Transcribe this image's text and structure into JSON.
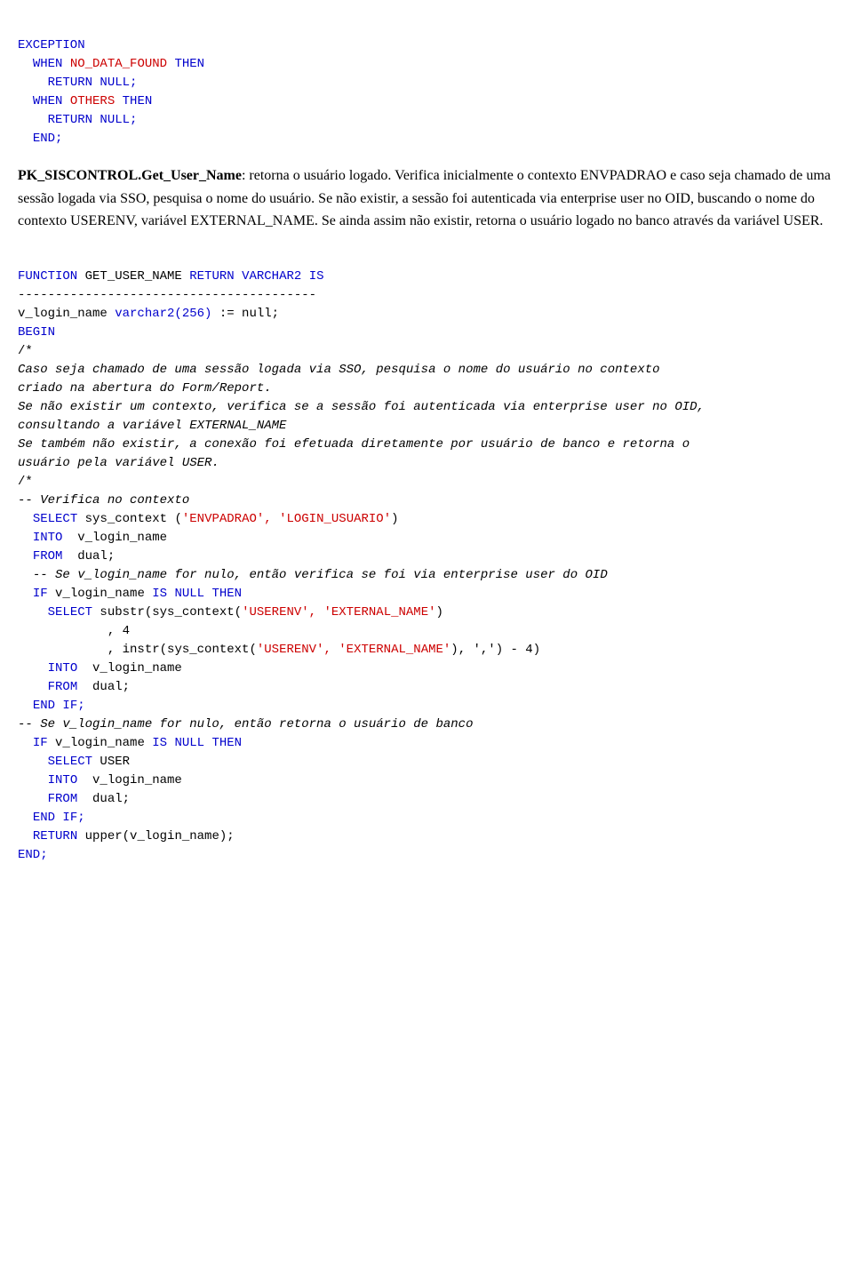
{
  "code_top": {
    "exception_block": [
      {
        "indent": 0,
        "text": "EXCEPTION",
        "color": "normal"
      },
      {
        "indent": 1,
        "text": "WHEN ",
        "color": "normal",
        "parts": [
          {
            "text": "WHEN ",
            "color": "blue"
          },
          {
            "text": "NO_DATA_FOUND",
            "color": "red"
          },
          {
            "text": " THEN",
            "color": "blue"
          }
        ]
      },
      {
        "indent": 2,
        "text": "RETURN NULL;",
        "color": "normal"
      },
      {
        "indent": 1,
        "text": "WHEN OTHERS THEN",
        "parts": [
          {
            "text": "WHEN ",
            "color": "blue"
          },
          {
            "text": "OTHERS",
            "color": "red"
          },
          {
            "text": " THEN",
            "color": "blue"
          }
        ]
      },
      {
        "indent": 2,
        "text": "RETURN NULL;",
        "color": "normal"
      },
      {
        "indent": 0,
        "text": "END;",
        "color": "blue"
      }
    ]
  },
  "prose_section": {
    "func_name": "PK_SISCONTROL.Get_User_Name",
    "colon_desc": ": retorna o usuário logado. Verifica inicialmente o contexto ENVPADRAO e caso seja chamado de uma sessão logada via SSO, pesquisa o nome do usuário. Se não existir, a sessão foi autenticada via enterprise user no OID, buscando o nome do contexto USERENV, variável EXTERNAL_NAME. Se ainda assim não existir, retorna o usuário logado no banco através da variável USER."
  },
  "code_function": {
    "signature_line": "FUNCTION GET_USER_NAME RETURN VARCHAR2 IS",
    "divider": "----------------------------------------",
    "var_line_pre": "v_login_name ",
    "var_line_type": "varchar2(256)",
    "var_line_post": " := null;",
    "begin": "BEGIN",
    "comment_open": "/*",
    "comment_lines": [
      "Caso seja chamado de uma sessão logada via SSO, pesquisa o nome do usuário no contexto",
      "criado na abertura do Form/Report.",
      "Se não existir um contexto, verifica se a sessão foi autenticada via enterprise user no OID,",
      "consultando a variável EXTERNAL_NAME",
      "Se também não existir, a conexão foi efetuada diretamente por usuário de banco e retorna o",
      "usuário pela variável USER."
    ],
    "comment_close": "/*",
    "inline_comment1": "-- Verifica no contexto",
    "select1_keyword": "SELECT",
    "select1_func": " sys_context (",
    "select1_args": "'ENVPADRAO', 'LOGIN_USUARIO'",
    "select1_close": ")",
    "into1_keyword": "INTO",
    "into1_var": "  v_login_name",
    "from1_keyword": "FROM",
    "from1_table": "  dual;",
    "inline_comment2": "-- Se v_login_name for nulo, então verifica se foi via enterprise user do OID",
    "if1_keyword": "IF",
    "if1_cond_pre": " v_login_name ",
    "if1_cond_kw1": "IS NULL",
    "if1_cond_kw2": " THEN",
    "select2_keyword": "  SELECT",
    "select2_func": " substr(sys_context(",
    "select2_args1": "'USERENV', 'EXTERNAL_NAME'",
    "select2_close1": ")",
    "select2_comma": "        , 4",
    "select2_instr": "        , instr(sys_context(",
    "select2_args2": "'USERENV', 'EXTERNAL_NAME'",
    "select2_close2": "), ',') - 4)",
    "into2_keyword": "  INTO",
    "into2_var": "  v_login_name",
    "from2_keyword": "  FROM",
    "from2_table": "  dual;",
    "endif1": "END IF;",
    "inline_comment3": "-- Se v_login_name for nulo, então retorna o usuário de banco",
    "if2_keyword": "IF",
    "if2_cond": " v_login_name IS NULL THEN",
    "select3_keyword": "  SELECT",
    "select3_rest": " USER",
    "into3_keyword": "  INTO",
    "into3_var": "  v_login_name",
    "from3_keyword": "  FROM",
    "from3_table": "  dual;",
    "endif2": "END IF;",
    "return_keyword": "RETURN",
    "return_expr": " upper(v_login_name);",
    "end_keyword": "END;"
  }
}
